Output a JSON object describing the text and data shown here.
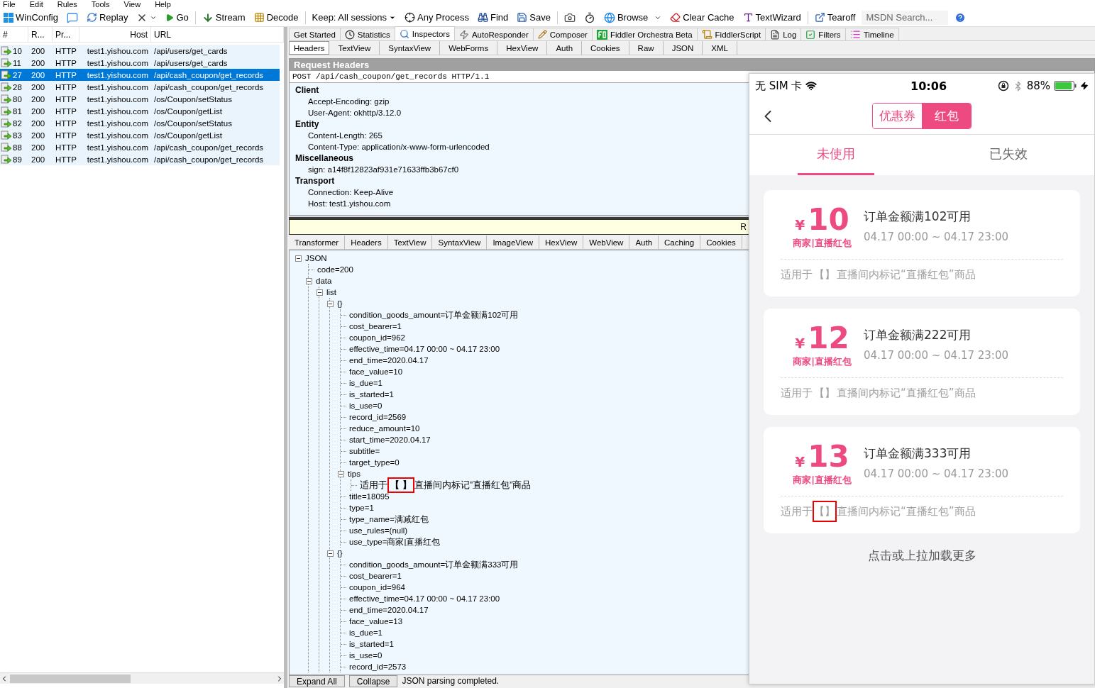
{
  "menu": [
    "File",
    "Edit",
    "Rules",
    "Tools",
    "View",
    "Help"
  ],
  "toolbar": [
    {
      "kind": "button",
      "label": "WinConfig"
    },
    {
      "kind": "icon-button"
    },
    {
      "kind": "button",
      "label": "Replay"
    },
    {
      "kind": "icon-dropdown"
    },
    {
      "kind": "button",
      "label": "Go"
    },
    {
      "kind": "separator"
    },
    {
      "kind": "button",
      "label": "Stream"
    },
    {
      "kind": "button",
      "label": "Decode"
    },
    {
      "kind": "separator"
    },
    {
      "kind": "dropdown",
      "label": "Keep: All sessions"
    },
    {
      "kind": "button",
      "label": "Any Process"
    },
    {
      "kind": "button",
      "label": "Find"
    },
    {
      "kind": "button",
      "label": "Save"
    },
    {
      "kind": "separator"
    },
    {
      "kind": "icon-button"
    },
    {
      "kind": "icon-button"
    },
    {
      "kind": "split",
      "label": "Browse"
    },
    {
      "kind": "button",
      "label": "Clear Cache"
    },
    {
      "kind": "button",
      "label": "TextWizard"
    },
    {
      "kind": "separator"
    },
    {
      "kind": "button",
      "label": "Tearoff"
    },
    {
      "kind": "search",
      "placeholder": "MSDN Search..."
    },
    {
      "kind": "icon-button"
    }
  ],
  "session_columns": [
    "#",
    "R...",
    "Pr...",
    "Host",
    "URL"
  ],
  "sessions": [
    {
      "id": "10",
      "result": "200",
      "protocol": "HTTP",
      "host": "test1.yishou.com",
      "url": "/api/users/get_cards",
      "selected": false
    },
    {
      "id": "11",
      "result": "200",
      "protocol": "HTTP",
      "host": "test1.yishou.com",
      "url": "/api/users/get_cards",
      "selected": false
    },
    {
      "id": "27",
      "result": "200",
      "protocol": "HTTP",
      "host": "test1.yishou.com",
      "url": "/api/cash_coupon/get_records",
      "selected": true
    },
    {
      "id": "28",
      "result": "200",
      "protocol": "HTTP",
      "host": "test1.yishou.com",
      "url": "/api/cash_coupon/get_records",
      "selected": false
    },
    {
      "id": "80",
      "result": "200",
      "protocol": "HTTP",
      "host": "test1.yishou.com",
      "url": "/os/Coupon/setStatus",
      "selected": false
    },
    {
      "id": "81",
      "result": "200",
      "protocol": "HTTP",
      "host": "test1.yishou.com",
      "url": "/os/Coupon/getList",
      "selected": false
    },
    {
      "id": "82",
      "result": "200",
      "protocol": "HTTP",
      "host": "test1.yishou.com",
      "url": "/os/Coupon/setStatus",
      "selected": false
    },
    {
      "id": "83",
      "result": "200",
      "protocol": "HTTP",
      "host": "test1.yishou.com",
      "url": "/os/Coupon/getList",
      "selected": false
    },
    {
      "id": "88",
      "result": "200",
      "protocol": "HTTP",
      "host": "test1.yishou.com",
      "url": "/api/cash_coupon/get_records",
      "selected": false
    },
    {
      "id": "89",
      "result": "200",
      "protocol": "HTTP",
      "host": "test1.yishou.com",
      "url": "/api/cash_coupon/get_records",
      "selected": false
    }
  ],
  "inspector_tabs": [
    {
      "label": "Get Started",
      "selected": false
    },
    {
      "label": "Statistics",
      "selected": false
    },
    {
      "label": "Inspectors",
      "selected": true
    },
    {
      "label": "AutoResponder",
      "selected": false
    },
    {
      "label": "Composer",
      "selected": false
    },
    {
      "label": "Fiddler Orchestra Beta",
      "selected": false
    },
    {
      "label": "FiddlerScript",
      "selected": false
    },
    {
      "label": "Log",
      "selected": false
    },
    {
      "label": "Filters",
      "selected": false
    },
    {
      "label": "Timeline",
      "selected": false
    }
  ],
  "request_tabs": [
    {
      "label": "Headers",
      "selected": true
    },
    {
      "label": "TextView",
      "selected": false
    },
    {
      "label": "SyntaxView",
      "selected": false
    },
    {
      "label": "WebForms",
      "selected": false
    },
    {
      "label": "HexView",
      "selected": false
    },
    {
      "label": "Auth",
      "selected": false
    },
    {
      "label": "Cookies",
      "selected": false
    },
    {
      "label": "Raw",
      "selected": false
    },
    {
      "label": "JSON",
      "selected": false
    },
    {
      "label": "XML",
      "selected": false
    }
  ],
  "request_headers": {
    "title": "Request Headers",
    "request_line": "POST /api/cash_coupon/get_records HTTP/1.1",
    "groups": [
      {
        "name": "Client",
        "items": [
          "Accept-Encoding: gzip",
          "User-Agent: okhttp/3.12.0"
        ]
      },
      {
        "name": "Entity",
        "items": [
          "Content-Length: 265",
          "Content-Type: application/x-www-form-urlencoded"
        ]
      },
      {
        "name": "Miscellaneous",
        "items": [
          "sign: a14f8f12823af931e71633ffb3b67cf0"
        ]
      },
      {
        "name": "Transport",
        "items": [
          "Connection: Keep-Alive",
          "Host: test1.yishou.com"
        ]
      }
    ]
  },
  "response_bar": {
    "text": "R"
  },
  "response_tabs": [
    {
      "label": "Transformer",
      "selected": false
    },
    {
      "label": "Headers",
      "selected": false
    },
    {
      "label": "TextView",
      "selected": false
    },
    {
      "label": "SyntaxView",
      "selected": false
    },
    {
      "label": "ImageView",
      "selected": false
    },
    {
      "label": "HexView",
      "selected": false
    },
    {
      "label": "WebView",
      "selected": false
    },
    {
      "label": "Auth",
      "selected": false
    },
    {
      "label": "Caching",
      "selected": false
    },
    {
      "label": "Cookies",
      "selected": false
    }
  ],
  "tree": [
    {
      "label": "JSON",
      "expanded": true,
      "children": [
        {
          "label": "code=200"
        },
        {
          "label": "data",
          "expanded": true,
          "children": [
            {
              "label": "list",
              "expanded": true,
              "children": [
                {
                  "label": "{}",
                  "expanded": true,
                  "children": [
                    {
                      "label": "condition_goods_amount=订单金额满102可用"
                    },
                    {
                      "label": "cost_bearer=1"
                    },
                    {
                      "label": "coupon_id=962"
                    },
                    {
                      "label": "effective_time=04.17 00:00 ~ 04.17 23:00"
                    },
                    {
                      "label": "end_time=2020.04.17"
                    },
                    {
                      "label": "face_value=10"
                    },
                    {
                      "label": "is_due=1"
                    },
                    {
                      "label": "is_started=1"
                    },
                    {
                      "label": "is_use=0"
                    },
                    {
                      "label": "record_id=2569"
                    },
                    {
                      "label": "reduce_amount=10"
                    },
                    {
                      "label": "start_time=2020.04.17"
                    },
                    {
                      "label": "subtitle="
                    },
                    {
                      "label": "target_type=0"
                    },
                    {
                      "label": "tips",
                      "expanded": true,
                      "children": [
                        {
                          "parts": [
                            "适用于",
                            "【 】",
                            "直播间内标记”直播红包”商品"
                          ],
                          "highlighted": true
                        }
                      ]
                    },
                    {
                      "label": "title=18095"
                    },
                    {
                      "label": "type=1"
                    },
                    {
                      "label": "type_name=满减红包"
                    },
                    {
                      "label": "use_rules=(null)"
                    },
                    {
                      "label": "use_type=商家|直播红包"
                    }
                  ]
                },
                {
                  "label": "{}",
                  "expanded": true,
                  "children": [
                    {
                      "label": "condition_goods_amount=订单金额满333可用"
                    },
                    {
                      "label": "cost_bearer=1"
                    },
                    {
                      "label": "coupon_id=964"
                    },
                    {
                      "label": "effective_time=04.17 00:00 ~ 04.17 23:00"
                    },
                    {
                      "label": "end_time=2020.04.17"
                    },
                    {
                      "label": "face_value=13"
                    },
                    {
                      "label": "is_due=1"
                    },
                    {
                      "label": "is_started=1"
                    },
                    {
                      "label": "is_use=0"
                    },
                    {
                      "label": "record_id=2573"
                    }
                  ]
                }
              ]
            }
          ]
        }
      ]
    }
  ],
  "tree_buttons": [
    "Expand All",
    "Collapse"
  ],
  "tree_status": "JSON parsing completed.",
  "phone": {
    "carrier": "无 SIM 卡",
    "time": "10:06",
    "battery": "88%",
    "segments": [
      {
        "label": "优惠券",
        "selected": false
      },
      {
        "label": "红包",
        "selected": true
      }
    ],
    "tabs": [
      {
        "label": "未使用",
        "selected": true
      },
      {
        "label": "已失效",
        "selected": false
      }
    ],
    "cards": [
      {
        "currency": "¥",
        "amount": "10",
        "type": "商家|直播红包",
        "title": "订单金额满102可用",
        "time": "04.17 00:00 ~ 04.17 23:00",
        "tip_parts": [
          "适用于",
          "【】",
          "直播间内标记“直播红包”商品"
        ],
        "highlighted": false
      },
      {
        "currency": "¥",
        "amount": "12",
        "type": "商家|直播红包",
        "title": "订单金额满222可用",
        "time": "04.17 00:00 ~ 04.17 23:00",
        "tip_parts": [
          "适用于",
          "【】",
          "直播间内标记“直播红包”商品"
        ],
        "highlighted": false
      },
      {
        "currency": "¥",
        "amount": "13",
        "type": "商家|直播红包",
        "title": "订单金额满333可用",
        "time": "04.17 00:00 ~ 04.17 23:00",
        "tip_parts": [
          "适用于",
          "【】",
          "直播间内标记“直播红包”商品"
        ],
        "highlighted": true
      }
    ],
    "footer": "点击或上拉加载更多"
  }
}
